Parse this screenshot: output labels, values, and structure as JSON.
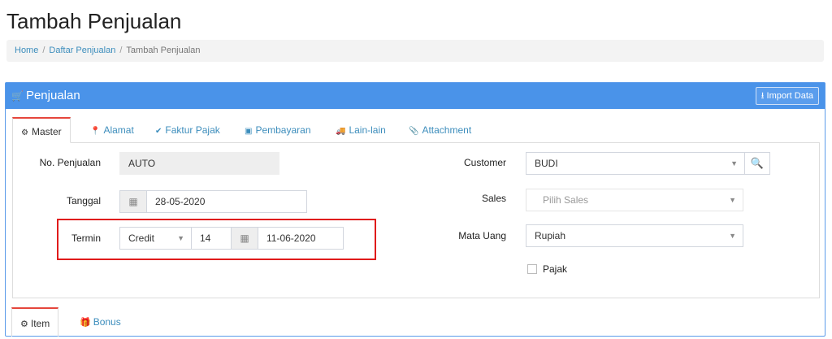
{
  "page": {
    "title": "Tambah Penjualan"
  },
  "breadcrumb": {
    "home": "Home",
    "list": "Daftar Penjualan",
    "current": "Tambah Penjualan",
    "separator": "/"
  },
  "panel": {
    "title": "Penjualan",
    "import_label": "Import Data"
  },
  "tabs": [
    {
      "label": "Master",
      "icon": "cogs-icon",
      "active": true
    },
    {
      "label": "Alamat",
      "icon": "map-marker-icon"
    },
    {
      "label": "Faktur Pajak",
      "icon": "check-circle-icon"
    },
    {
      "label": "Pembayaran",
      "icon": "money-icon"
    },
    {
      "label": "Lain-lain",
      "icon": "truck-icon"
    },
    {
      "label": "Attachment",
      "icon": "paperclip-icon"
    }
  ],
  "form": {
    "no_penjualan": {
      "label": "No. Penjualan",
      "value": "AUTO"
    },
    "tanggal": {
      "label": "Tanggal",
      "value": "28-05-2020"
    },
    "termin": {
      "label": "Termin",
      "type": "Credit",
      "days": "14",
      "due_date": "11-06-2020"
    },
    "customer": {
      "label": "Customer",
      "value": "BUDI"
    },
    "sales": {
      "label": "Sales",
      "placeholder": "Pilih Sales"
    },
    "mata_uang": {
      "label": "Mata Uang",
      "value": "Rupiah"
    },
    "pajak": {
      "label": "Pajak",
      "checked": false
    }
  },
  "bottom_tabs": [
    {
      "label": "Item",
      "icon": "cubes-icon",
      "active": true
    },
    {
      "label": "Bonus",
      "icon": "gift-icon"
    }
  ],
  "colors": {
    "header": "#4a93e9",
    "link": "#3c8dbc",
    "highlight": "#e01b1b",
    "active_tab": "#e5463c"
  }
}
